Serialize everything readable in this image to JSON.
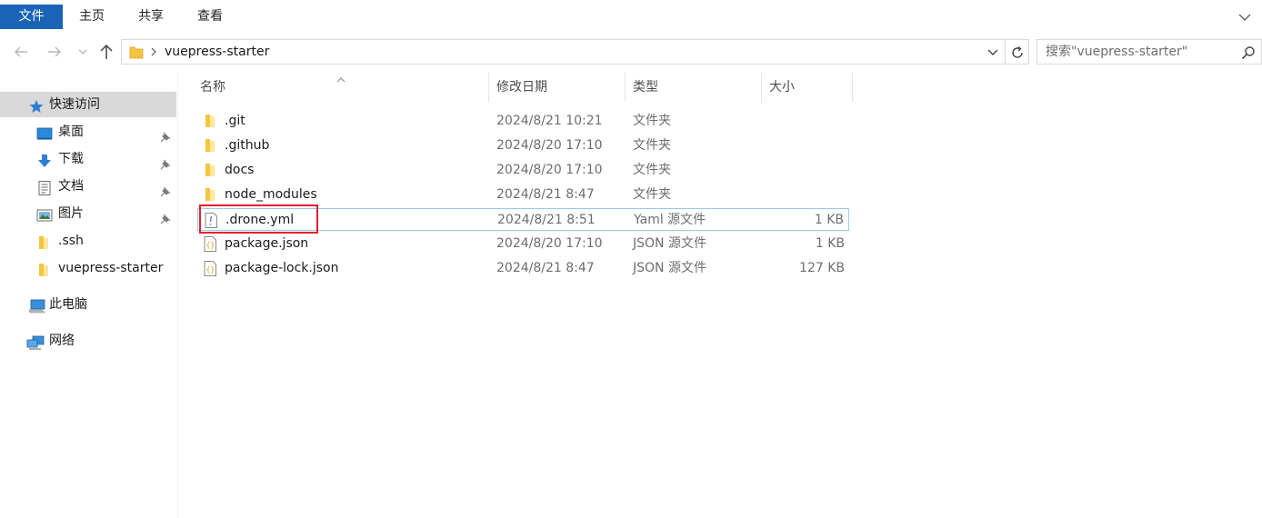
{
  "ribbon": {
    "tabs": [
      {
        "label": "文件"
      },
      {
        "label": "主页"
      },
      {
        "label": "共享"
      },
      {
        "label": "查看"
      }
    ]
  },
  "address": {
    "path": "vuepress-starter"
  },
  "search": {
    "placeholder": "搜索\"vuepress-starter\""
  },
  "nav": {
    "quick_access": "快速访问",
    "items": [
      {
        "label": "桌面",
        "icon": "desktop-icon",
        "pinned": true
      },
      {
        "label": "下载",
        "icon": "download-icon",
        "pinned": true
      },
      {
        "label": "文档",
        "icon": "documents-icon",
        "pinned": true
      },
      {
        "label": "图片",
        "icon": "pictures-icon",
        "pinned": true
      },
      {
        "label": ".ssh",
        "icon": "folder-icon",
        "pinned": false
      },
      {
        "label": "vuepress-starter",
        "icon": "folder-icon",
        "pinned": false
      }
    ],
    "this_pc": "此电脑",
    "network": "网络"
  },
  "columns": {
    "name": "名称",
    "date": "修改日期",
    "type": "类型",
    "size": "大小"
  },
  "files": [
    {
      "name": ".git",
      "date": "2024/8/21 10:21",
      "type": "文件夹",
      "size": "",
      "icon": "folder-icon"
    },
    {
      "name": ".github",
      "date": "2024/8/20 17:10",
      "type": "文件夹",
      "size": "",
      "icon": "folder-icon"
    },
    {
      "name": "docs",
      "date": "2024/8/20 17:10",
      "type": "文件夹",
      "size": "",
      "icon": "folder-icon"
    },
    {
      "name": "node_modules",
      "date": "2024/8/21 8:47",
      "type": "文件夹",
      "size": "",
      "icon": "folder-icon"
    },
    {
      "name": ".drone.yml",
      "date": "2024/8/21 8:51",
      "type": "Yaml 源文件",
      "size": "1 KB",
      "icon": "yaml-file-icon"
    },
    {
      "name": "package.json",
      "date": "2024/8/20 17:10",
      "type": "JSON 源文件",
      "size": "1 KB",
      "icon": "json-file-icon"
    },
    {
      "name": "package-lock.json",
      "date": "2024/8/21 8:47",
      "type": "JSON 源文件",
      "size": "127 KB",
      "icon": "json-file-icon"
    }
  ],
  "colors": {
    "file_tab_bg": "#1a64b8",
    "folder": "#f4c542",
    "highlight_border": "#99c9ef",
    "annotation_box": "#e0212f",
    "selected_nav_bg": "#d9d9d9"
  }
}
